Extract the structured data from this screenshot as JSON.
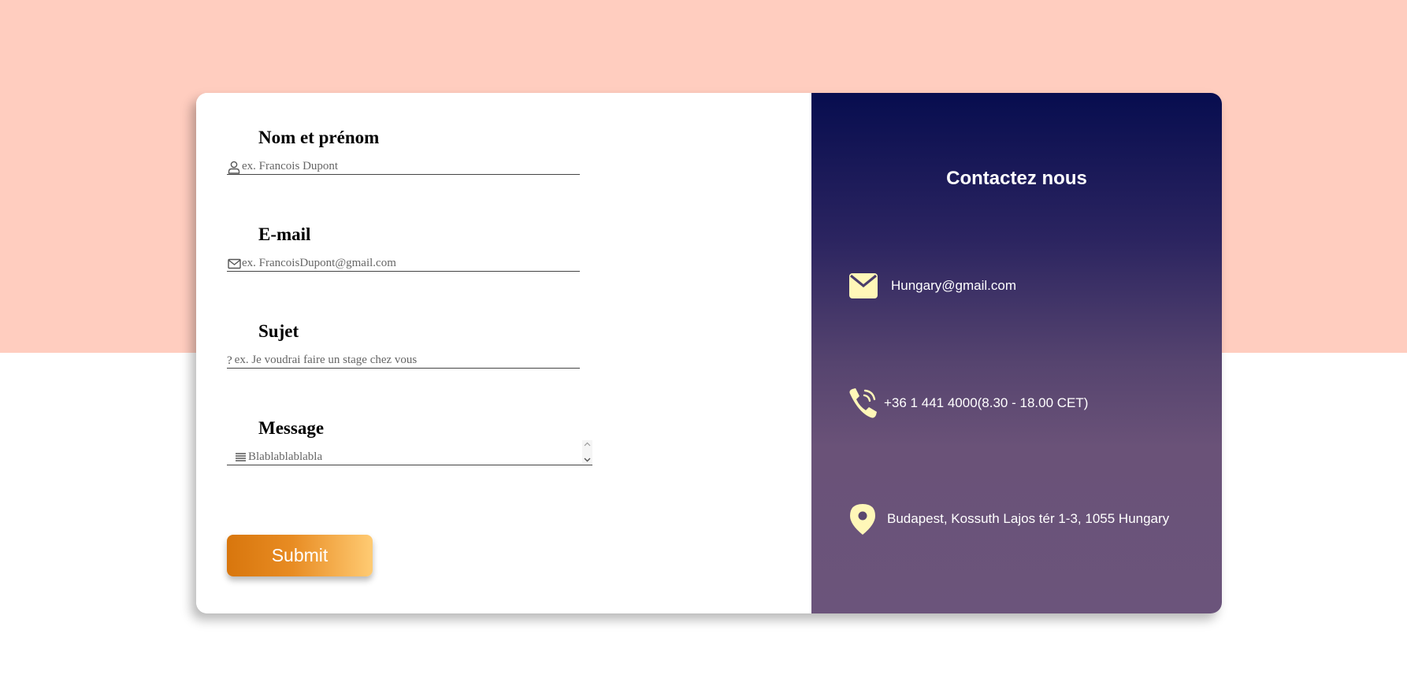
{
  "form": {
    "name_label": "Nom et prénom",
    "name_placeholder": "ex. Francois Dupont",
    "email_label": "E-mail",
    "email_placeholder": "ex. FrancoisDupont@gmail.com",
    "subject_label": "Sujet",
    "subject_icon": "?",
    "subject_placeholder": "ex. Je voudrai faire un stage chez vous",
    "message_label": "Message",
    "message_placeholder": "Blablablablabla",
    "submit_label": "Submit"
  },
  "contact": {
    "title": "Contactez nous",
    "email": "Hungary@gmail.com",
    "phone": "+36 1 441 4000(8.30 - 18.00 CET)",
    "address": "Budapest, Kossuth Lajos tér 1-3, 1055 Hungary"
  },
  "icons": {
    "name": "user-icon",
    "email": "envelope-icon",
    "subject": "question-mark-icon",
    "message": "lines-icon",
    "contact_email": "envelope-icon",
    "contact_phone": "phone-icon",
    "contact_address": "map-pin-icon"
  },
  "colors": {
    "background_top": "#ffcdbf",
    "panel_gradient_top": "#070d4f",
    "panel_gradient_bottom": "#6b547b",
    "icon_accent": "#fff7b8",
    "button_start": "#d8760d",
    "button_end": "#ffcb73"
  }
}
